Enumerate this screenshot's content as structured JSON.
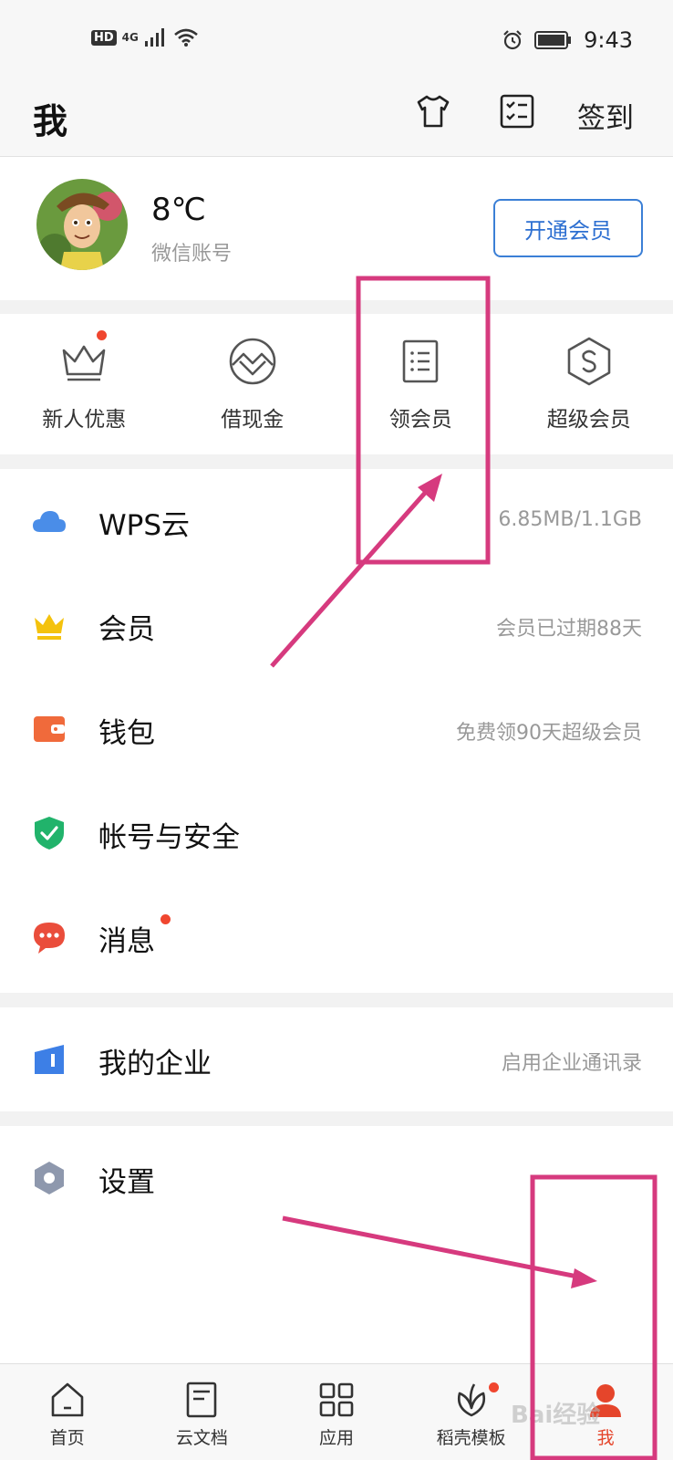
{
  "status_bar": {
    "network_badge": "HD",
    "network_type": "4G",
    "time": "9:43"
  },
  "header": {
    "title": "我",
    "signin_label": "签到",
    "icons": [
      "tshirt-icon",
      "checklist-icon"
    ]
  },
  "profile": {
    "name": "8℃",
    "sub": "微信账号",
    "vip_button": "开通会员"
  },
  "quick_actions": [
    {
      "label": "新人优惠",
      "icon": "crown-outline-icon",
      "has_dot": true
    },
    {
      "label": "借现金",
      "icon": "mountain-circle-icon",
      "has_dot": false
    },
    {
      "label": "领会员",
      "icon": "list-doc-icon",
      "has_dot": false
    },
    {
      "label": "超级会员",
      "icon": "s-hexagon-icon",
      "has_dot": false
    }
  ],
  "menu": [
    {
      "label": "WPS云",
      "value": "6.85MB/1.1GB",
      "icon": "cloud-icon"
    },
    {
      "label": "会员",
      "value": "会员已过期88天",
      "icon": "crown-icon"
    },
    {
      "label": "钱包",
      "value": "免费领90天超级会员",
      "icon": "wallet-icon"
    },
    {
      "label": "帐号与安全",
      "value": "",
      "icon": "shield-icon"
    },
    {
      "label": "消息",
      "value": "",
      "icon": "chat-icon",
      "has_dot": true
    }
  ],
  "enterprise": {
    "label": "我的企业",
    "value": "启用企业通讯录",
    "icon": "enterprise-icon"
  },
  "settings": {
    "label": "设置",
    "icon": "hex-settings-icon"
  },
  "tabs": [
    {
      "label": "首页",
      "icon": "home-icon"
    },
    {
      "label": "云文档",
      "icon": "document-icon"
    },
    {
      "label": "应用",
      "icon": "grid-icon"
    },
    {
      "label": "稻壳模板",
      "icon": "leaf-icon",
      "has_dot": true
    },
    {
      "label": "我",
      "icon": "person-icon",
      "active": true
    }
  ],
  "watermark": "Bai经验",
  "colors": {
    "accent_blue": "#2d6fd1",
    "active_red": "#e5452b",
    "annotation_pink": "#d63a7e"
  }
}
